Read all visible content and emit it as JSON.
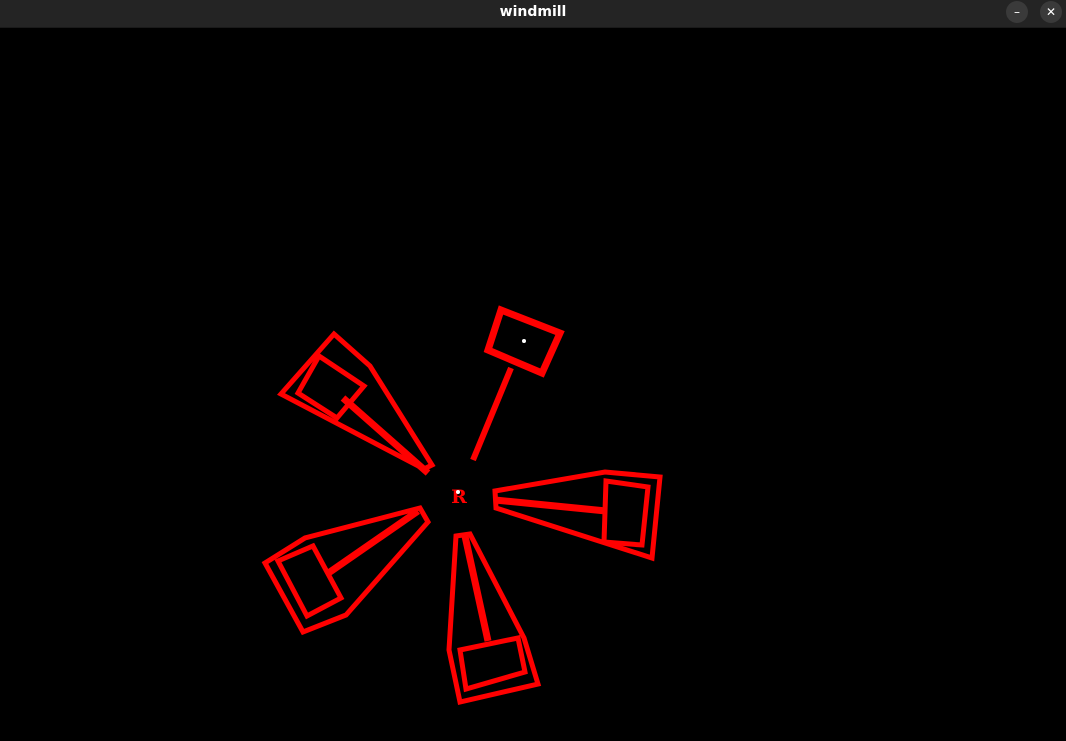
{
  "window": {
    "title": "windmill",
    "buttons": {
      "minimize_icon": "–",
      "close_icon": "✕"
    }
  },
  "canvas": {
    "background_color": "#000000",
    "mark_color": "#ff0000",
    "target_point_color": "#ffffff",
    "center_label": "R",
    "blade_count": 5,
    "active_blade_count": 1
  }
}
